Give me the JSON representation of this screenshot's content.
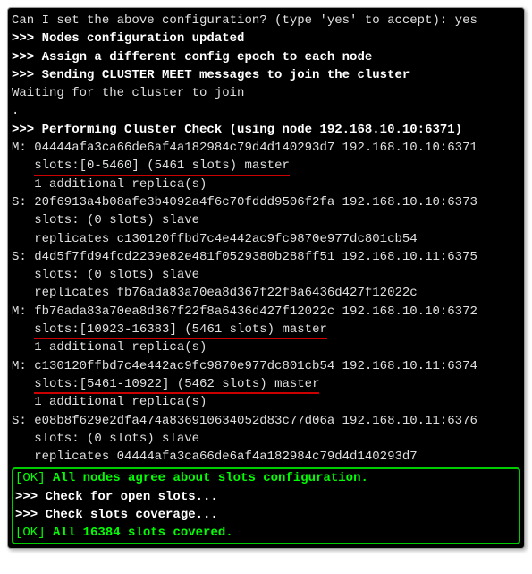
{
  "l0": "Can I set the above configuration? (type 'yes' to accept): yes",
  "l1": ">>> Nodes configuration updated",
  "l2": ">>> Assign a different config epoch to each node",
  "l3": ">>> Sending CLUSTER MEET messages to join the cluster",
  "l4": "Waiting for the cluster to join",
  "l5": ".",
  "l6": ">>> Performing Cluster Check (using node 192.168.10.10:6371)",
  "l7": "M: 04444afa3ca66de6af4a182984c79d4d140293d7 192.168.10.10:6371",
  "l8a": "   ",
  "l8b": "slots:[0-5460] (5461 slots) master",
  "l9": "   1 additional replica(s)",
  "l10": "S: 20f6913a4b08afe3b4092a4f6c70fddd9506f2fa 192.168.10.10:6373",
  "l11": "   slots: (0 slots) slave",
  "l12": "   replicates c130120ffbd7c4e442ac9fc9870e977dc801cb54",
  "l13": "S: d4d5f7fd94fcd2239e82e481f0529380b288ff51 192.168.10.11:6375",
  "l14": "   slots: (0 slots) slave",
  "l15": "   replicates fb76ada83a70ea8d367f22f8a6436d427f12022c",
  "l16": "M: fb76ada83a70ea8d367f22f8a6436d427f12022c 192.168.10.10:6372",
  "l17a": "   ",
  "l17b": "slots:[10923-16383] (5461 slots) master",
  "l18": "   1 additional replica(s)",
  "l19": "M: c130120ffbd7c4e442ac9fc9870e977dc801cb54 192.168.10.11:6374",
  "l20a": "   ",
  "l20b": "slots:[5461-10922] (5462 slots) master",
  "l21": "   1 additional replica(s)",
  "l22": "S: e08b8f629e2dfa474a836910634052d83c77d06a 192.168.10.11:6376",
  "l23": "   slots: (0 slots) slave",
  "l24": "   replicates 04444afa3ca66de6af4a182984c79d4d140293d7",
  "ok1a": "[OK] ",
  "ok1b": "All nodes agree about slots configuration.",
  "l26": ">>> Check for open slots...",
  "l27": ">>> Check slots coverage...",
  "ok2a": "[OK] ",
  "ok2b": "All 16384 slots covered."
}
